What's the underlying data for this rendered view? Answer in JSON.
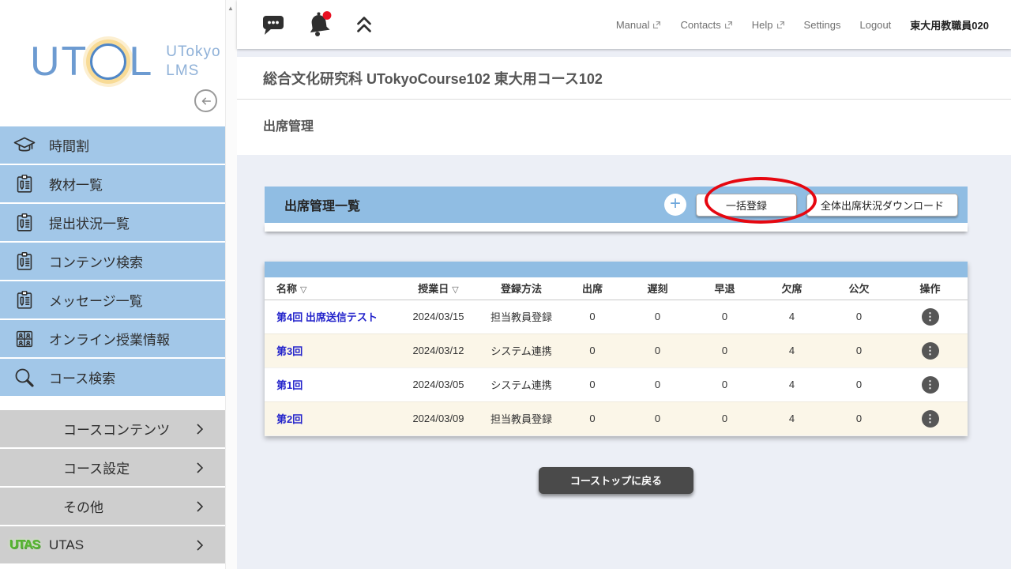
{
  "brand": {
    "logo_left": "UT",
    "logo_right": "L",
    "logo_sub_line1": "UTokyo",
    "logo_sub_line2": "LMS"
  },
  "topbar": {
    "links": [
      {
        "label": "Manual",
        "external": true
      },
      {
        "label": "Contacts",
        "external": true
      },
      {
        "label": "Help",
        "external": true
      },
      {
        "label": "Settings",
        "external": false
      },
      {
        "label": "Logout",
        "external": false
      }
    ],
    "user": "東大用教職員020",
    "icons": [
      "message-icon",
      "bell-icon",
      "collapse-up-icon"
    ]
  },
  "sidebar": {
    "blue_items": [
      {
        "label": "時間割",
        "icon": "graduation-cap-icon"
      },
      {
        "label": "教材一覧",
        "icon": "clipboard-icon"
      },
      {
        "label": "提出状況一覧",
        "icon": "clipboard-icon"
      },
      {
        "label": "コンテンツ検索",
        "icon": "clipboard-icon"
      },
      {
        "label": "メッセージ一覧",
        "icon": "clipboard-icon"
      },
      {
        "label": "オンライン授業情報",
        "icon": "online-class-icon"
      },
      {
        "label": "コース検索",
        "icon": "search-icon"
      }
    ],
    "gray_items": [
      {
        "label": "コースコンテンツ"
      },
      {
        "label": "コース設定"
      },
      {
        "label": "その他"
      },
      {
        "label": "UTAS",
        "icon": "utas-logo"
      }
    ],
    "utas_logo_text": "UTAS"
  },
  "page": {
    "course_title": "総合文化研究科 UTokyoCourse102 東大用コース102",
    "section_title": "出席管理"
  },
  "panel": {
    "title": "出席管理一覧",
    "plus_label": "+",
    "bulk_register_button": "一括登録",
    "download_button": "全体出席状況ダウンロード",
    "annotation": "red-ellipse-highlight-on-bulk-register"
  },
  "table": {
    "headers": {
      "name": "名称",
      "date": "授業日",
      "method": "登録方法",
      "attend": "出席",
      "late": "遅刻",
      "early": "早退",
      "absent": "欠席",
      "official": "公欠",
      "ops": "操作"
    },
    "sort_glyph": "▽",
    "ops_glyph": "⋮",
    "rows": [
      {
        "name": "第4回 出席送信テスト",
        "date": "2024/03/15",
        "method": "担当教員登録",
        "attend": "0",
        "late": "0",
        "early": "0",
        "absent": "4",
        "official": "0"
      },
      {
        "name": "第3回",
        "date": "2024/03/12",
        "method": "システム連携",
        "attend": "0",
        "late": "0",
        "early": "0",
        "absent": "4",
        "official": "0"
      },
      {
        "name": "第1回",
        "date": "2024/03/05",
        "method": "システム連携",
        "attend": "0",
        "late": "0",
        "early": "0",
        "absent": "4",
        "official": "0"
      },
      {
        "name": "第2回",
        "date": "2024/03/09",
        "method": "担当教員登録",
        "attend": "0",
        "late": "0",
        "early": "0",
        "absent": "4",
        "official": "0"
      }
    ]
  },
  "footer": {
    "back_button": "コーストップに戻る"
  },
  "colors": {
    "sidebar_blue": "#a2c7e8",
    "sidebar_gray": "#cecece",
    "panel_blue": "#90bde3",
    "row_cream": "#fbf6e8",
    "link_blue": "#2424cb",
    "annotation_red": "#e60710",
    "dark_button": "#4a4a4a",
    "notification_red": "#e81022"
  },
  "scrollbar": {
    "up_arrow": "▲"
  }
}
